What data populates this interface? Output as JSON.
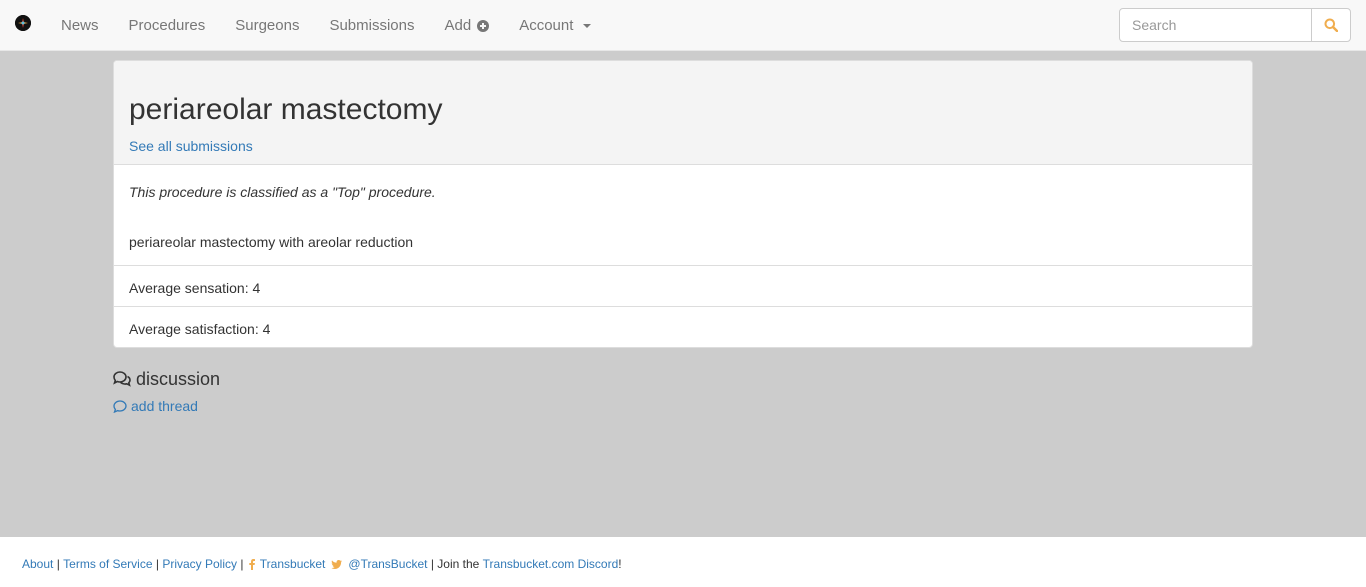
{
  "nav": {
    "items": [
      {
        "label": "News"
      },
      {
        "label": "Procedures"
      },
      {
        "label": "Surgeons"
      },
      {
        "label": "Submissions"
      },
      {
        "label": "Add"
      },
      {
        "label": "Account"
      }
    ],
    "add_icon": "plus-circle-icon",
    "account_icon": "caret-down-icon",
    "search_placeholder": "Search",
    "search_icon": "search-icon",
    "search_icon_color": "#f0ad4e"
  },
  "procedure": {
    "title": "periareolar mastectomy",
    "see_all_link": "See all submissions",
    "classification": "This procedure is classified as a \"Top\" procedure.",
    "description": "periareolar mastectomy with areolar reduction",
    "avg_sensation": "Average sensation: 4",
    "avg_satisfaction": "Average satisfaction: 4"
  },
  "discussion": {
    "heading": "discussion",
    "heading_icon": "comments-icon",
    "add_thread": "add thread",
    "add_thread_icon": "comment-icon"
  },
  "footer": {
    "about": "About",
    "sep1": " | ",
    "terms": "Terms of Service",
    "sep2": " | ",
    "privacy": "Privacy Policy",
    "sep3": " | ",
    "facebook": "Transbucket",
    "twitter": "@TransBucket",
    "join_prefix": " | Join the ",
    "discord": "Transbucket.com Discord",
    "join_suffix": "!"
  },
  "colors": {
    "link": "#337ab7",
    "page_bg": "#cccccc",
    "navbar_bg": "#f8f8f8",
    "social_icon": "#f0ad4e"
  }
}
